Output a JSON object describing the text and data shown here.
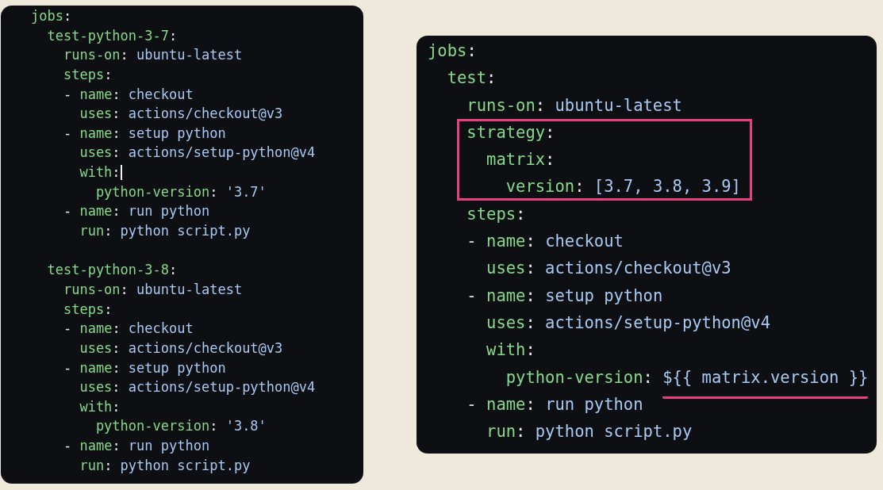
{
  "panels": [
    {
      "kind": "compact",
      "lines": [
        {
          "kind": "code",
          "segments": [
            {
              "text": "jobs",
              "kind": "key"
            },
            {
              "text": ":",
              "kind": "punct"
            }
          ]
        },
        {
          "kind": "code",
          "segments": [
            {
              "text": "  test-python-3-7",
              "kind": "key"
            },
            {
              "text": ":",
              "kind": "punct"
            }
          ]
        },
        {
          "kind": "code",
          "segments": [
            {
              "text": "    runs-on",
              "kind": "key"
            },
            {
              "text": ": ",
              "kind": "punct"
            },
            {
              "text": "ubuntu-latest",
              "kind": "value"
            }
          ]
        },
        {
          "kind": "code",
          "segments": [
            {
              "text": "    steps",
              "kind": "key"
            },
            {
              "text": ":",
              "kind": "punct"
            }
          ]
        },
        {
          "kind": "code",
          "segments": [
            {
              "text": "    - ",
              "kind": "punct"
            },
            {
              "text": "name",
              "kind": "key"
            },
            {
              "text": ": ",
              "kind": "punct"
            },
            {
              "text": "checkout",
              "kind": "value"
            }
          ]
        },
        {
          "kind": "code",
          "segments": [
            {
              "text": "      uses",
              "kind": "key"
            },
            {
              "text": ": ",
              "kind": "punct"
            },
            {
              "text": "actions/checkout@v3",
              "kind": "value"
            }
          ]
        },
        {
          "kind": "code",
          "segments": [
            {
              "text": "    - ",
              "kind": "punct"
            },
            {
              "text": "name",
              "kind": "key"
            },
            {
              "text": ": ",
              "kind": "punct"
            },
            {
              "text": "setup python",
              "kind": "value"
            }
          ]
        },
        {
          "kind": "code",
          "segments": [
            {
              "text": "      uses",
              "kind": "key"
            },
            {
              "text": ": ",
              "kind": "punct"
            },
            {
              "text": "actions/setup-python@v4",
              "kind": "value"
            }
          ]
        },
        {
          "kind": "code",
          "cursor": true,
          "segments": [
            {
              "text": "      with",
              "kind": "key"
            },
            {
              "text": ":",
              "kind": "punct"
            }
          ]
        },
        {
          "kind": "code",
          "segments": [
            {
              "text": "        python-version",
              "kind": "key"
            },
            {
              "text": ": ",
              "kind": "punct"
            },
            {
              "text": "'3.7'",
              "kind": "value"
            }
          ]
        },
        {
          "kind": "code",
          "segments": [
            {
              "text": "    - ",
              "kind": "punct"
            },
            {
              "text": "name",
              "kind": "key"
            },
            {
              "text": ": ",
              "kind": "punct"
            },
            {
              "text": "run python",
              "kind": "value"
            }
          ]
        },
        {
          "kind": "code",
          "segments": [
            {
              "text": "      run",
              "kind": "key"
            },
            {
              "text": ": ",
              "kind": "punct"
            },
            {
              "text": "python script.py",
              "kind": "value"
            }
          ]
        },
        {
          "kind": "blank"
        },
        {
          "kind": "code",
          "segments": [
            {
              "text": "  test-python-3-8",
              "kind": "key"
            },
            {
              "text": ":",
              "kind": "punct"
            }
          ]
        },
        {
          "kind": "code",
          "segments": [
            {
              "text": "    runs-on",
              "kind": "key"
            },
            {
              "text": ": ",
              "kind": "punct"
            },
            {
              "text": "ubuntu-latest",
              "kind": "value"
            }
          ]
        },
        {
          "kind": "code",
          "segments": [
            {
              "text": "    steps",
              "kind": "key"
            },
            {
              "text": ":",
              "kind": "punct"
            }
          ]
        },
        {
          "kind": "code",
          "segments": [
            {
              "text": "    - ",
              "kind": "punct"
            },
            {
              "text": "name",
              "kind": "key"
            },
            {
              "text": ": ",
              "kind": "punct"
            },
            {
              "text": "checkout",
              "kind": "value"
            }
          ]
        },
        {
          "kind": "code",
          "segments": [
            {
              "text": "      uses",
              "kind": "key"
            },
            {
              "text": ": ",
              "kind": "punct"
            },
            {
              "text": "actions/checkout@v3",
              "kind": "value"
            }
          ]
        },
        {
          "kind": "code",
          "segments": [
            {
              "text": "    - ",
              "kind": "punct"
            },
            {
              "text": "name",
              "kind": "key"
            },
            {
              "text": ": ",
              "kind": "punct"
            },
            {
              "text": "setup python",
              "kind": "value"
            }
          ]
        },
        {
          "kind": "code",
          "segments": [
            {
              "text": "      uses",
              "kind": "key"
            },
            {
              "text": ": ",
              "kind": "punct"
            },
            {
              "text": "actions/setup-python@v4",
              "kind": "value"
            }
          ]
        },
        {
          "kind": "code",
          "segments": [
            {
              "text": "      with",
              "kind": "key"
            },
            {
              "text": ":",
              "kind": "punct"
            }
          ]
        },
        {
          "kind": "code",
          "segments": [
            {
              "text": "        python-version",
              "kind": "key"
            },
            {
              "text": ": ",
              "kind": "punct"
            },
            {
              "text": "'3.8'",
              "kind": "value"
            }
          ]
        },
        {
          "kind": "code",
          "segments": [
            {
              "text": "    - ",
              "kind": "punct"
            },
            {
              "text": "name",
              "kind": "key"
            },
            {
              "text": ": ",
              "kind": "punct"
            },
            {
              "text": "run python",
              "kind": "value"
            }
          ]
        },
        {
          "kind": "code",
          "segments": [
            {
              "text": "      run",
              "kind": "key"
            },
            {
              "text": ": ",
              "kind": "punct"
            },
            {
              "text": "python script.py",
              "kind": "value"
            }
          ]
        }
      ]
    },
    {
      "kind": "zoomed",
      "lines": [
        {
          "kind": "code",
          "segments": [
            {
              "text": "jobs",
              "kind": "key"
            },
            {
              "text": ":",
              "kind": "punct"
            }
          ]
        },
        {
          "kind": "code",
          "segments": [
            {
              "text": "  test",
              "kind": "key"
            },
            {
              "text": ":",
              "kind": "punct"
            }
          ]
        },
        {
          "kind": "code",
          "segments": [
            {
              "text": "    runs-on",
              "kind": "key"
            },
            {
              "text": ": ",
              "kind": "punct"
            },
            {
              "text": "ubuntu-latest",
              "kind": "value"
            }
          ]
        },
        {
          "kind": "group",
          "boxed": true,
          "lines": [
            {
              "kind": "code",
              "segments": [
                {
                  "text": "    strategy",
                  "kind": "key"
                },
                {
                  "text": ":",
                  "kind": "punct"
                }
              ]
            },
            {
              "kind": "code",
              "segments": [
                {
                  "text": "      matrix",
                  "kind": "key"
                },
                {
                  "text": ":",
                  "kind": "punct"
                }
              ]
            },
            {
              "kind": "code",
              "segments": [
                {
                  "text": "        version",
                  "kind": "key"
                },
                {
                  "text": ": ",
                  "kind": "punct"
                },
                {
                  "text": "[3.7, 3.8, 3.9]",
                  "kind": "value"
                }
              ]
            }
          ]
        },
        {
          "kind": "code",
          "segments": [
            {
              "text": "    steps",
              "kind": "key"
            },
            {
              "text": ":",
              "kind": "punct"
            }
          ]
        },
        {
          "kind": "code",
          "segments": [
            {
              "text": "    - ",
              "kind": "punct"
            },
            {
              "text": "name",
              "kind": "key"
            },
            {
              "text": ": ",
              "kind": "punct"
            },
            {
              "text": "checkout",
              "kind": "value"
            }
          ]
        },
        {
          "kind": "code",
          "segments": [
            {
              "text": "      uses",
              "kind": "key"
            },
            {
              "text": ": ",
              "kind": "punct"
            },
            {
              "text": "actions/checkout@v3",
              "kind": "value"
            }
          ]
        },
        {
          "kind": "code",
          "segments": [
            {
              "text": "    - ",
              "kind": "punct"
            },
            {
              "text": "name",
              "kind": "key"
            },
            {
              "text": ": ",
              "kind": "punct"
            },
            {
              "text": "setup python",
              "kind": "value"
            }
          ]
        },
        {
          "kind": "code",
          "segments": [
            {
              "text": "      uses",
              "kind": "key"
            },
            {
              "text": ": ",
              "kind": "punct"
            },
            {
              "text": "actions/setup-python@v4",
              "kind": "value"
            }
          ]
        },
        {
          "kind": "code",
          "segments": [
            {
              "text": "      with",
              "kind": "key"
            },
            {
              "text": ":",
              "kind": "punct"
            }
          ]
        },
        {
          "kind": "code",
          "segments": [
            {
              "text": "        python-version",
              "kind": "key"
            },
            {
              "text": ": ",
              "kind": "punct"
            },
            {
              "text": "${{ matrix.version }}",
              "kind": "value",
              "underlined": true
            }
          ]
        },
        {
          "kind": "code",
          "segments": [
            {
              "text": "    - ",
              "kind": "punct"
            },
            {
              "text": "name",
              "kind": "key"
            },
            {
              "text": ": ",
              "kind": "punct"
            },
            {
              "text": "run python",
              "kind": "value"
            }
          ]
        },
        {
          "kind": "code",
          "segments": [
            {
              "text": "      run",
              "kind": "key"
            },
            {
              "text": ": ",
              "kind": "punct"
            },
            {
              "text": "python script.py",
              "kind": "value"
            }
          ]
        }
      ]
    }
  ]
}
